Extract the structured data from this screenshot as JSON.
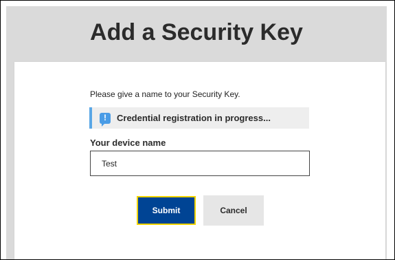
{
  "page": {
    "title": "Add a Security Key"
  },
  "form": {
    "instruction": "Please give a name to your Security Key.",
    "status_message": "Credential registration in progress...",
    "device_name_label": "Your device name",
    "device_name_value": "Test",
    "submit_label": "Submit",
    "cancel_label": "Cancel"
  },
  "icons": {
    "status": "info-exclamation-icon"
  },
  "colors": {
    "backdrop": "#dadada",
    "banner_accent": "#5aa7e6",
    "submit_bg": "#004494",
    "submit_focus_border": "#f2d400",
    "cancel_bg": "#e6e6e6"
  }
}
